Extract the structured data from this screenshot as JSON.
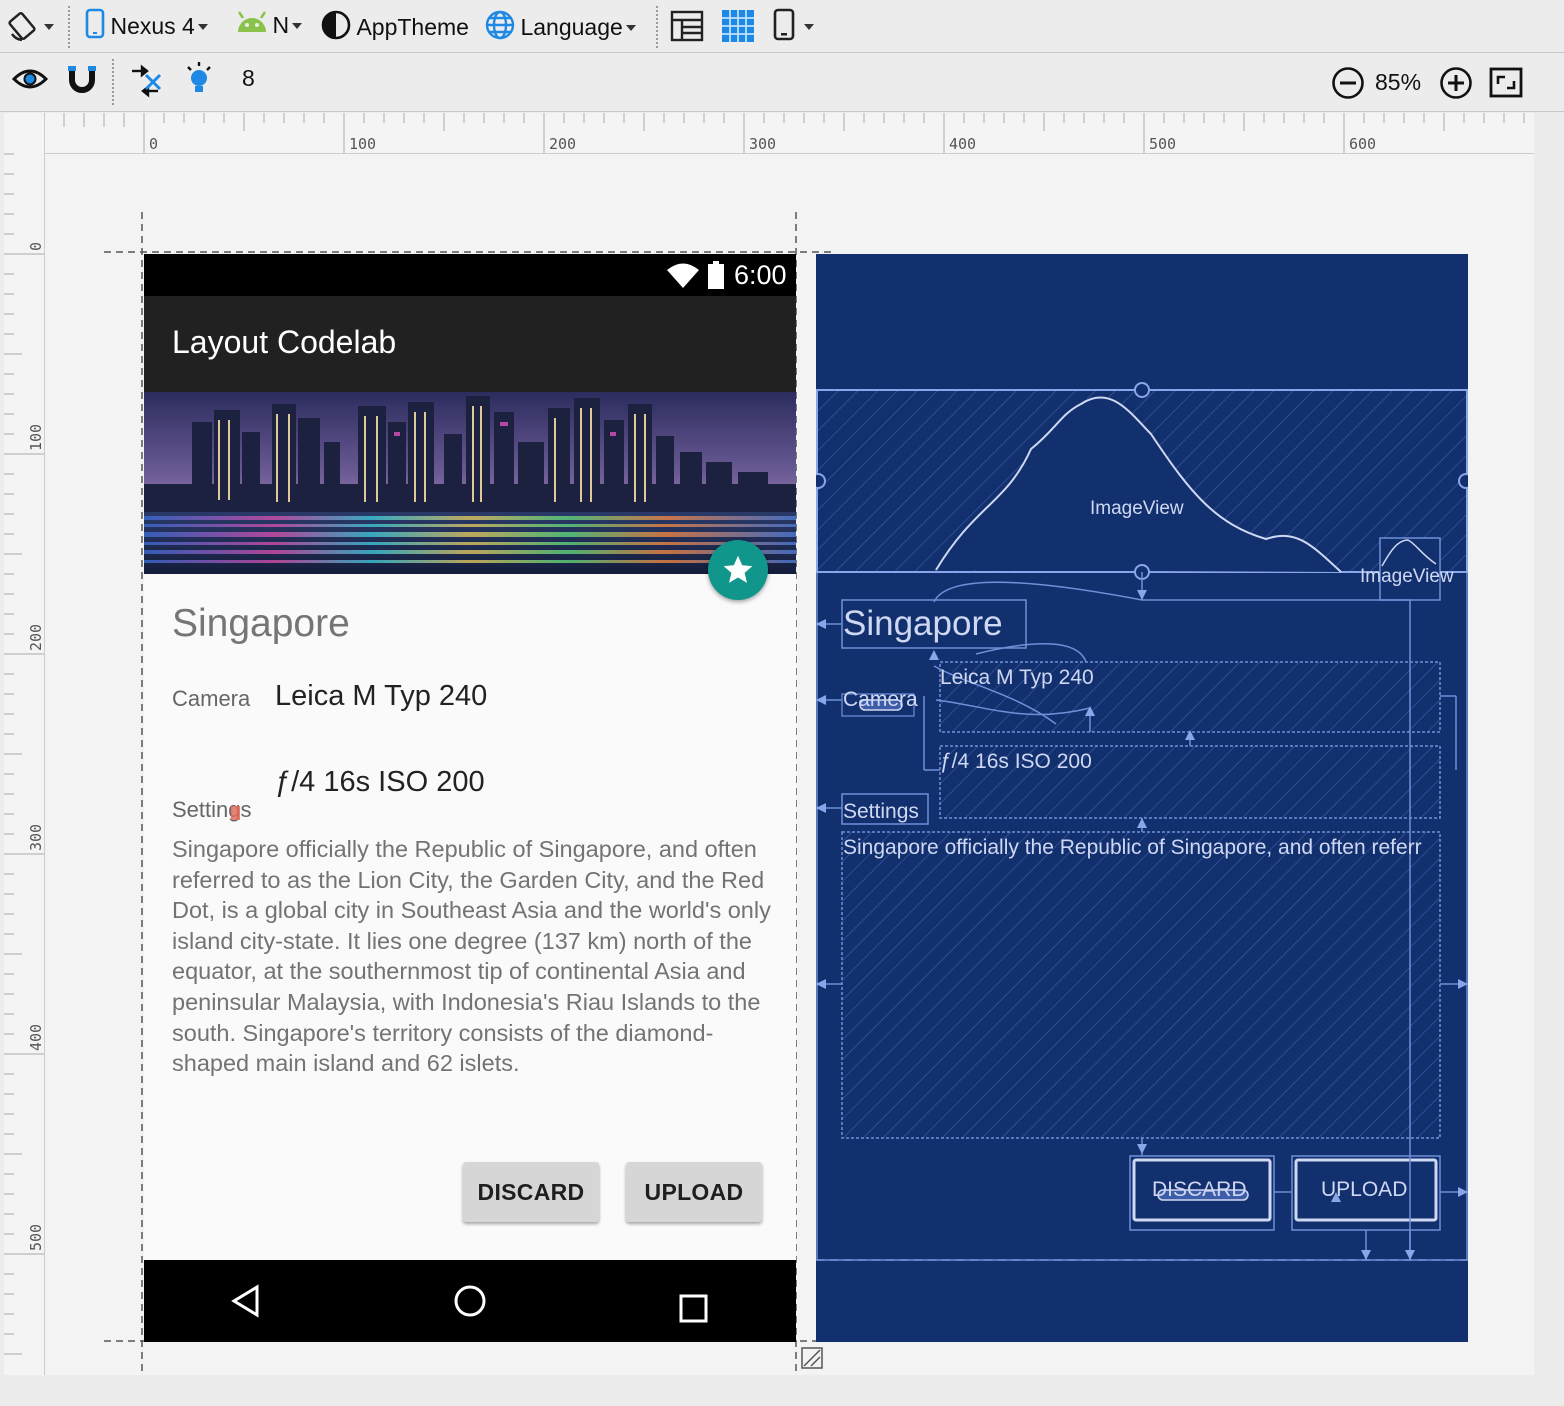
{
  "toolbar": {
    "device": "Nexus 4",
    "api": "N",
    "theme": "AppTheme",
    "language": "Language"
  },
  "toolbar2": {
    "margin_value": "8",
    "zoom": "85%"
  },
  "ruler": {
    "h_labels": [
      "0",
      "100",
      "200",
      "300",
      "400",
      "500",
      "600"
    ],
    "v_labels": [
      "0",
      "100",
      "200",
      "300",
      "400",
      "500"
    ]
  },
  "device": {
    "clock": "6:00",
    "app_title": "Layout Codelab",
    "heading": "Singapore",
    "camera_label": "Camera",
    "camera_value": "Leica M Typ 240",
    "settings_label": "Settings",
    "settings_value": "ƒ/4 16s ISO 200",
    "description": "Singapore officially the Republic of Singapore, and often referred to as the Lion City, the Garden City, and the Red Dot, is a global city in Southeast Asia and the world's only island city-state. It lies one degree (137 km) north of the equator, at the southernmost tip of continental Asia and peninsular Malaysia, with Indonesia's Riau Islands to the south. Singapore's territory consists of the diamond-shaped main island and 62 islets.",
    "discard": "DISCARD",
    "upload": "UPLOAD"
  },
  "blueprint": {
    "imageview_main": "ImageView",
    "imageview_small": "ImageView",
    "heading": "Singapore",
    "camera_label": "Camera",
    "camera_value": "Leica M Typ 240",
    "settings_value": "ƒ/4 16s ISO 200",
    "settings_label": "Settings",
    "description": "Singapore officially the Republic of Singapore, and often referr",
    "discard": "DISCARD",
    "upload": "UPLOAD"
  },
  "colors": {
    "blueprint_bg": "#13306e",
    "blueprint_line": "#6f8fd8",
    "fab": "#11968b",
    "appbar": "#212121"
  },
  "icons": [
    "orientation-icon",
    "phone-icon",
    "android-icon",
    "theme-icon",
    "globe-icon",
    "design-view-icon",
    "blueprint-view-icon",
    "device-frame-icon",
    "eye-icon",
    "magnet-icon",
    "clear-constraints-icon",
    "lightbulb-icon",
    "zoom-out-icon",
    "zoom-in-icon",
    "zoom-fit-icon",
    "wifi-icon",
    "battery-icon",
    "back-icon",
    "home-icon",
    "recents-icon",
    "star-icon",
    "resize-icon"
  ]
}
